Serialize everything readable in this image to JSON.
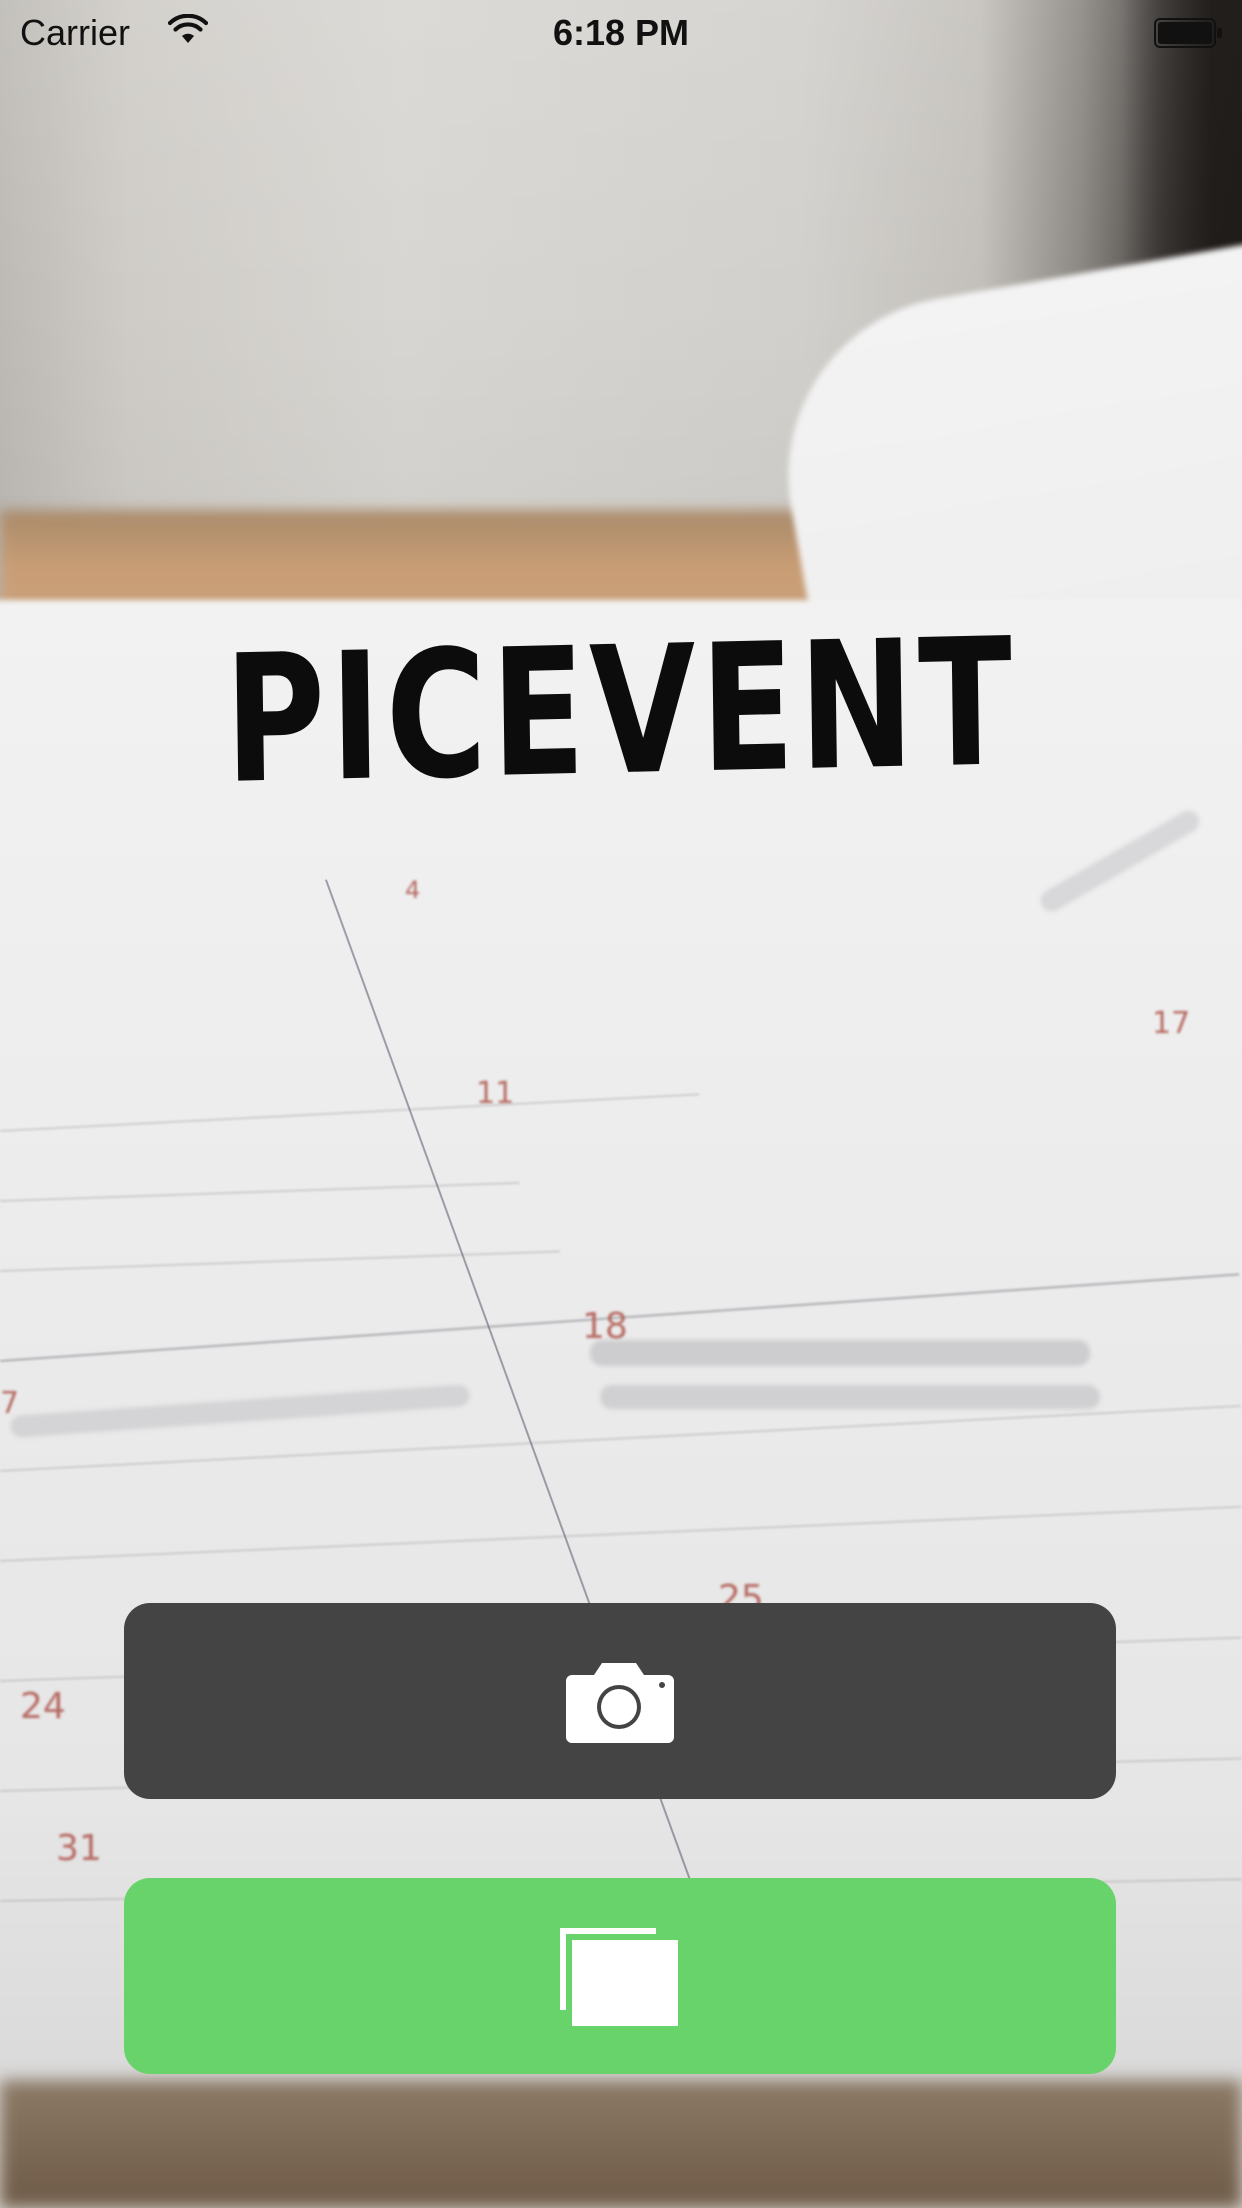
{
  "status_bar": {
    "carrier": "Carrier",
    "time": "6:18 PM",
    "wifi_icon": "wifi-icon",
    "battery_icon": "battery-icon"
  },
  "app": {
    "logo_text": "PICEVENT"
  },
  "background": {
    "description_icon": "planner-photo",
    "calendar_numbers": [
      "4",
      "11",
      "18",
      "25",
      "24",
      "31",
      "17",
      "7"
    ]
  },
  "buttons": {
    "camera": {
      "icon": "camera-icon",
      "color": "#444444"
    },
    "gallery": {
      "icon": "photo-library-icon",
      "color": "#67d36a"
    }
  }
}
